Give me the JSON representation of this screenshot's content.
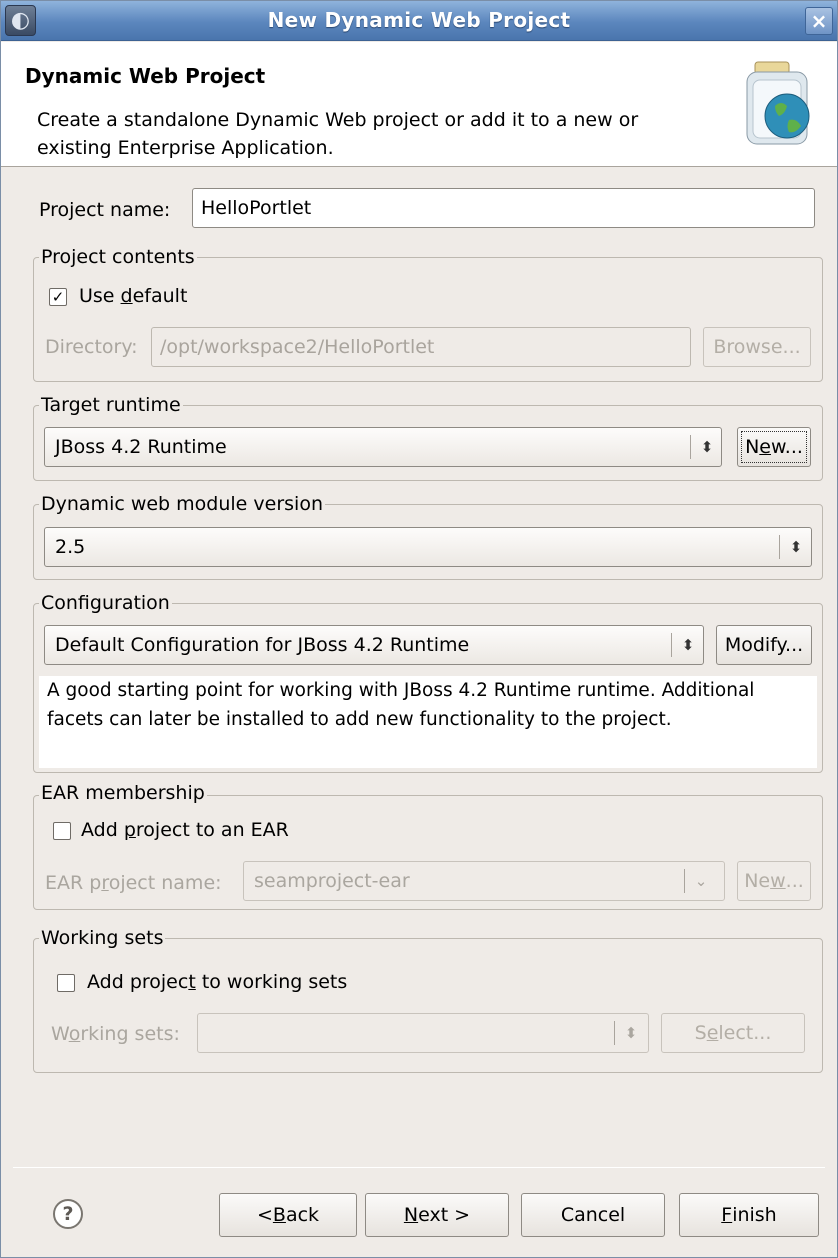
{
  "window": {
    "title": "New Dynamic Web Project",
    "app_icon": "eclipse-icon",
    "close_glyph": "×"
  },
  "header": {
    "title": "Dynamic Web Project",
    "description": "Create a standalone Dynamic Web project or add it to a new or existing Enterprise Application.",
    "icon": "web-project-wizard-icon"
  },
  "project_name": {
    "label": "Project name:",
    "value": "HelloPortlet"
  },
  "project_contents": {
    "title": "Project contents",
    "use_default_label": "Use default",
    "use_default_checked": true,
    "directory_label": "Directory:",
    "directory_value": "/opt/workspace2/HelloPortlet",
    "browse_label": "Browse..."
  },
  "target_runtime": {
    "title": "Target runtime",
    "selected": "JBoss 4.2 Runtime",
    "new_label": "New..."
  },
  "module_version": {
    "title": "Dynamic web module version",
    "selected": "2.5"
  },
  "configuration": {
    "title": "Configuration",
    "selected": "Default Configuration for JBoss 4.2 Runtime",
    "modify_label": "Modify...",
    "description": "A good starting point for working with JBoss 4.2 Runtime runtime. Additional facets can later be installed to add new functionality to the project."
  },
  "ear_membership": {
    "title": "EAR membership",
    "add_label": "Add project to an EAR",
    "add_checked": false,
    "project_name_label": "EAR project name:",
    "project_name_value": "seamproject-ear",
    "new_label": "New..."
  },
  "working_sets": {
    "title": "Working sets",
    "add_label": "Add project to working sets",
    "add_checked": false,
    "sets_label": "Working sets:",
    "sets_value": "",
    "select_label": "Select..."
  },
  "footer": {
    "help_glyph": "?",
    "back_label": "< Back",
    "next_label": "Next >",
    "cancel_label": "Cancel",
    "finish_label": "Finish"
  },
  "glyphs": {
    "check": "✓",
    "spinner": "⬍",
    "dropdown": "⌄"
  }
}
